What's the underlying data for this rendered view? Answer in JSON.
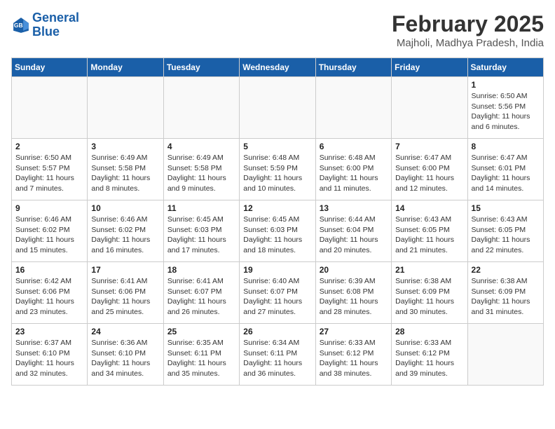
{
  "logo": {
    "line1": "General",
    "line2": "Blue"
  },
  "title": "February 2025",
  "subtitle": "Majholi, Madhya Pradesh, India",
  "weekdays": [
    "Sunday",
    "Monday",
    "Tuesday",
    "Wednesday",
    "Thursday",
    "Friday",
    "Saturday"
  ],
  "weeks": [
    [
      {
        "day": "",
        "info": ""
      },
      {
        "day": "",
        "info": ""
      },
      {
        "day": "",
        "info": ""
      },
      {
        "day": "",
        "info": ""
      },
      {
        "day": "",
        "info": ""
      },
      {
        "day": "",
        "info": ""
      },
      {
        "day": "1",
        "info": "Sunrise: 6:50 AM\nSunset: 5:56 PM\nDaylight: 11 hours and 6 minutes."
      }
    ],
    [
      {
        "day": "2",
        "info": "Sunrise: 6:50 AM\nSunset: 5:57 PM\nDaylight: 11 hours and 7 minutes."
      },
      {
        "day": "3",
        "info": "Sunrise: 6:49 AM\nSunset: 5:58 PM\nDaylight: 11 hours and 8 minutes."
      },
      {
        "day": "4",
        "info": "Sunrise: 6:49 AM\nSunset: 5:58 PM\nDaylight: 11 hours and 9 minutes."
      },
      {
        "day": "5",
        "info": "Sunrise: 6:48 AM\nSunset: 5:59 PM\nDaylight: 11 hours and 10 minutes."
      },
      {
        "day": "6",
        "info": "Sunrise: 6:48 AM\nSunset: 6:00 PM\nDaylight: 11 hours and 11 minutes."
      },
      {
        "day": "7",
        "info": "Sunrise: 6:47 AM\nSunset: 6:00 PM\nDaylight: 11 hours and 12 minutes."
      },
      {
        "day": "8",
        "info": "Sunrise: 6:47 AM\nSunset: 6:01 PM\nDaylight: 11 hours and 14 minutes."
      }
    ],
    [
      {
        "day": "9",
        "info": "Sunrise: 6:46 AM\nSunset: 6:02 PM\nDaylight: 11 hours and 15 minutes."
      },
      {
        "day": "10",
        "info": "Sunrise: 6:46 AM\nSunset: 6:02 PM\nDaylight: 11 hours and 16 minutes."
      },
      {
        "day": "11",
        "info": "Sunrise: 6:45 AM\nSunset: 6:03 PM\nDaylight: 11 hours and 17 minutes."
      },
      {
        "day": "12",
        "info": "Sunrise: 6:45 AM\nSunset: 6:03 PM\nDaylight: 11 hours and 18 minutes."
      },
      {
        "day": "13",
        "info": "Sunrise: 6:44 AM\nSunset: 6:04 PM\nDaylight: 11 hours and 20 minutes."
      },
      {
        "day": "14",
        "info": "Sunrise: 6:43 AM\nSunset: 6:05 PM\nDaylight: 11 hours and 21 minutes."
      },
      {
        "day": "15",
        "info": "Sunrise: 6:43 AM\nSunset: 6:05 PM\nDaylight: 11 hours and 22 minutes."
      }
    ],
    [
      {
        "day": "16",
        "info": "Sunrise: 6:42 AM\nSunset: 6:06 PM\nDaylight: 11 hours and 23 minutes."
      },
      {
        "day": "17",
        "info": "Sunrise: 6:41 AM\nSunset: 6:06 PM\nDaylight: 11 hours and 25 minutes."
      },
      {
        "day": "18",
        "info": "Sunrise: 6:41 AM\nSunset: 6:07 PM\nDaylight: 11 hours and 26 minutes."
      },
      {
        "day": "19",
        "info": "Sunrise: 6:40 AM\nSunset: 6:07 PM\nDaylight: 11 hours and 27 minutes."
      },
      {
        "day": "20",
        "info": "Sunrise: 6:39 AM\nSunset: 6:08 PM\nDaylight: 11 hours and 28 minutes."
      },
      {
        "day": "21",
        "info": "Sunrise: 6:38 AM\nSunset: 6:09 PM\nDaylight: 11 hours and 30 minutes."
      },
      {
        "day": "22",
        "info": "Sunrise: 6:38 AM\nSunset: 6:09 PM\nDaylight: 11 hours and 31 minutes."
      }
    ],
    [
      {
        "day": "23",
        "info": "Sunrise: 6:37 AM\nSunset: 6:10 PM\nDaylight: 11 hours and 32 minutes."
      },
      {
        "day": "24",
        "info": "Sunrise: 6:36 AM\nSunset: 6:10 PM\nDaylight: 11 hours and 34 minutes."
      },
      {
        "day": "25",
        "info": "Sunrise: 6:35 AM\nSunset: 6:11 PM\nDaylight: 11 hours and 35 minutes."
      },
      {
        "day": "26",
        "info": "Sunrise: 6:34 AM\nSunset: 6:11 PM\nDaylight: 11 hours and 36 minutes."
      },
      {
        "day": "27",
        "info": "Sunrise: 6:33 AM\nSunset: 6:12 PM\nDaylight: 11 hours and 38 minutes."
      },
      {
        "day": "28",
        "info": "Sunrise: 6:33 AM\nSunset: 6:12 PM\nDaylight: 11 hours and 39 minutes."
      },
      {
        "day": "",
        "info": ""
      }
    ]
  ]
}
